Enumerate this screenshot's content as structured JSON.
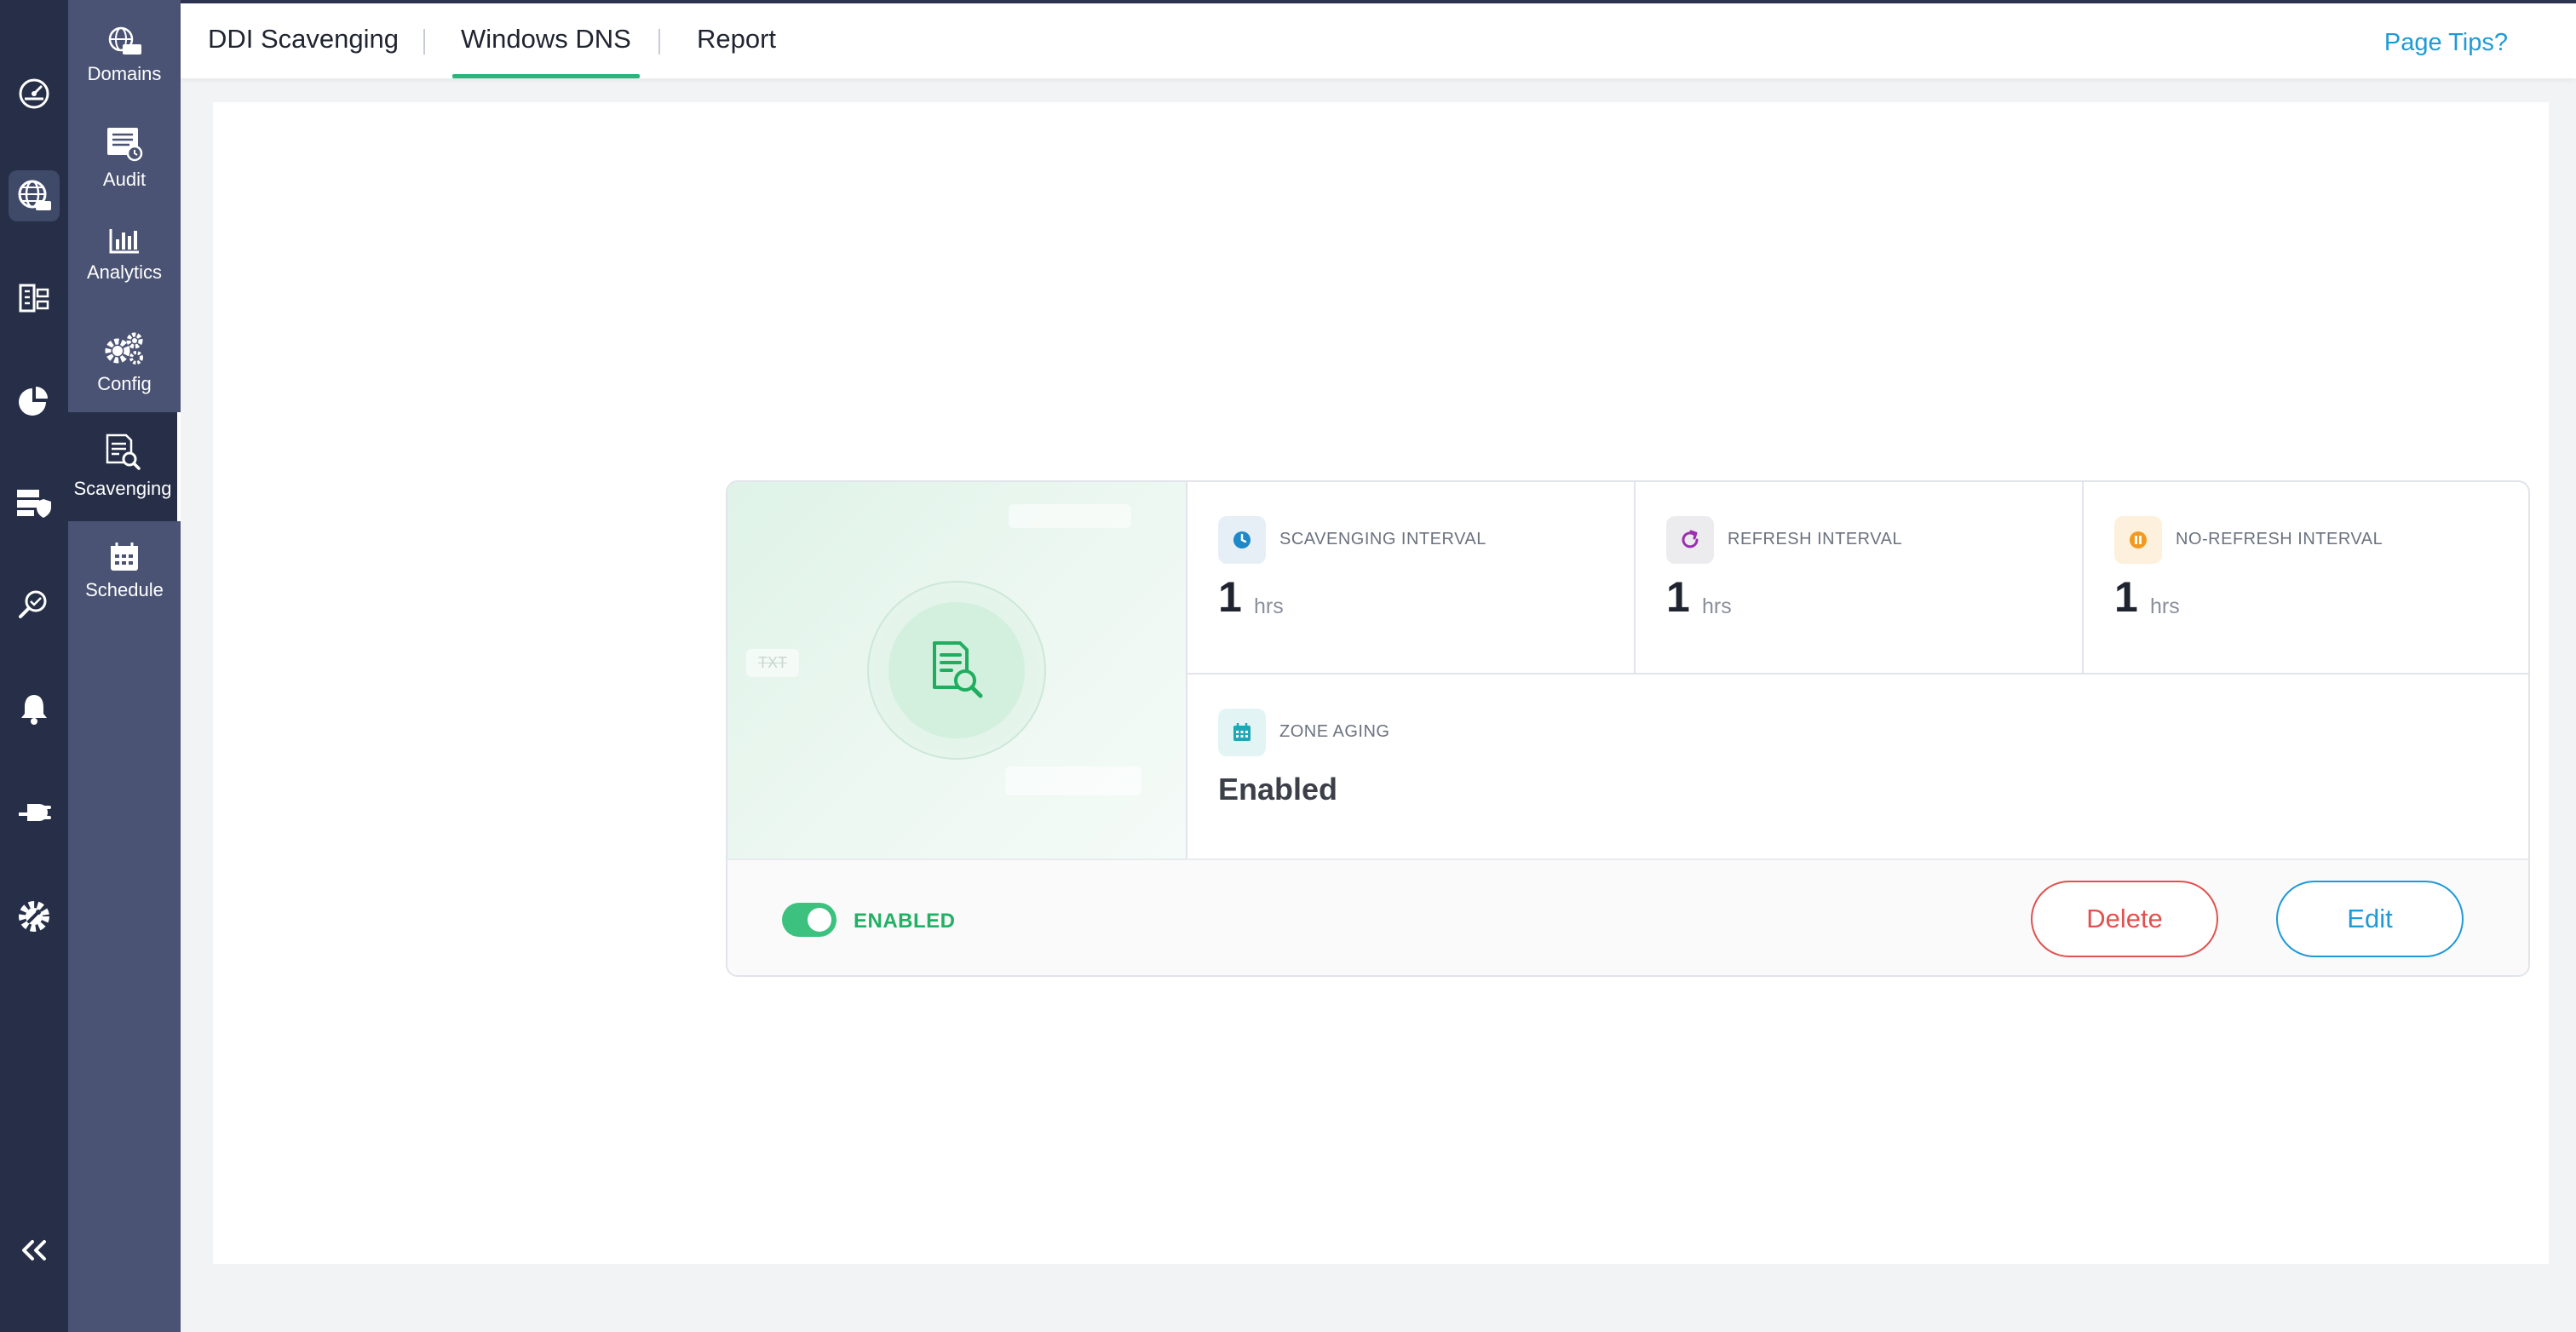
{
  "header": {
    "tabs": [
      {
        "label": "DDI Scavenging"
      },
      {
        "label": "Windows DNS"
      },
      {
        "label": "Report"
      }
    ],
    "active_tab": "Windows DNS",
    "page_tips": "Page Tips?"
  },
  "rail": {
    "items": [
      "dashboard-icon",
      "dns-globe-icon",
      "ipam-icon",
      "analytics-pie-icon",
      "security-server-icon",
      "search-investigate-icon",
      "bell-icon",
      "plug-icon",
      "settings-gear-icon",
      "collapse-icon"
    ],
    "active": "dns-globe-icon"
  },
  "subnav": {
    "items": [
      {
        "label": "Domains",
        "icon": "globe-com-icon"
      },
      {
        "label": "Audit",
        "icon": "audit-icon"
      },
      {
        "label": "Analytics",
        "icon": "bar-chart-icon"
      },
      {
        "label": "Config",
        "icon": "gears-icon"
      },
      {
        "label": "Scavenging",
        "icon": "document-search-icon"
      },
      {
        "label": "Schedule",
        "icon": "calendar-icon"
      }
    ],
    "active": "Scavenging"
  },
  "card": {
    "hero": {
      "ghost_tags": [
        "TXT",
        "",
        ""
      ]
    },
    "stats": [
      {
        "label": "SCAVENGING INTERVAL",
        "value": "1",
        "unit": "hrs",
        "icon": "clock-icon",
        "color": "#1e88c8"
      },
      {
        "label": "REFRESH INTERVAL",
        "value": "1",
        "unit": "hrs",
        "icon": "refresh-icon",
        "color": "#9b2fb0"
      },
      {
        "label": "NO-REFRESH INTERVAL",
        "value": "1",
        "unit": "hrs",
        "icon": "pause-icon",
        "color": "#f29a1f"
      }
    ],
    "aging": {
      "label": "ZONE AGING",
      "value": "Enabled",
      "icon": "calendar-icon",
      "color": "#1fa7b8"
    },
    "footer": {
      "status": "ENABLED",
      "enabled": true,
      "delete_label": "Delete",
      "edit_label": "Edit"
    }
  },
  "colors": {
    "accent_green": "#26b77c",
    "link_blue": "#1e9ad6",
    "danger_red": "#e0524f",
    "rail_bg": "#262f47",
    "subnav_bg": "#4a5373"
  }
}
